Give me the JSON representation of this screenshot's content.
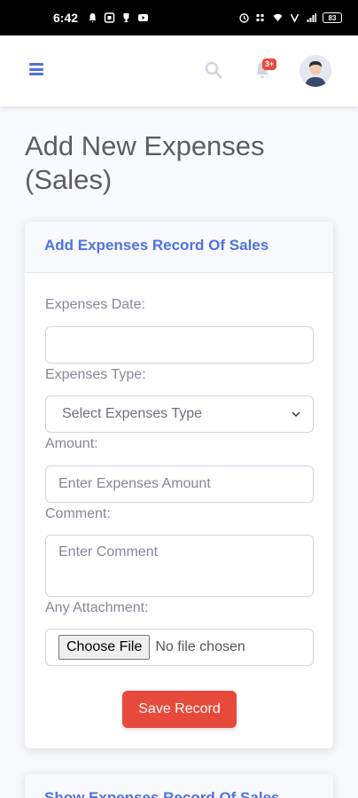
{
  "status_bar": {
    "time": "6:42",
    "battery": "83"
  },
  "nav": {
    "notification_badge": "3+"
  },
  "page": {
    "title": "Add New Expenses (Sales)"
  },
  "form_card": {
    "header": "Add Expenses Record Of Sales",
    "date_label": "Expenses Date:",
    "date_value": "",
    "type_label": "Expenses Type:",
    "type_selected": "Select Expenses Type",
    "amount_label": "Amount:",
    "amount_placeholder": "Enter Expenses Amount",
    "comment_label": "Comment:",
    "comment_placeholder": "Enter Comment",
    "attachment_label": "Any Attachment:",
    "choose_file_label": "Choose File",
    "file_status": "No file chosen",
    "save_label": "Save Record"
  },
  "list_card": {
    "header": "Show Expenses Record Of Sales"
  },
  "colors": {
    "primary": "#4e73df",
    "danger": "#e74a3b",
    "text": "#5a5c69",
    "muted": "#858796"
  }
}
